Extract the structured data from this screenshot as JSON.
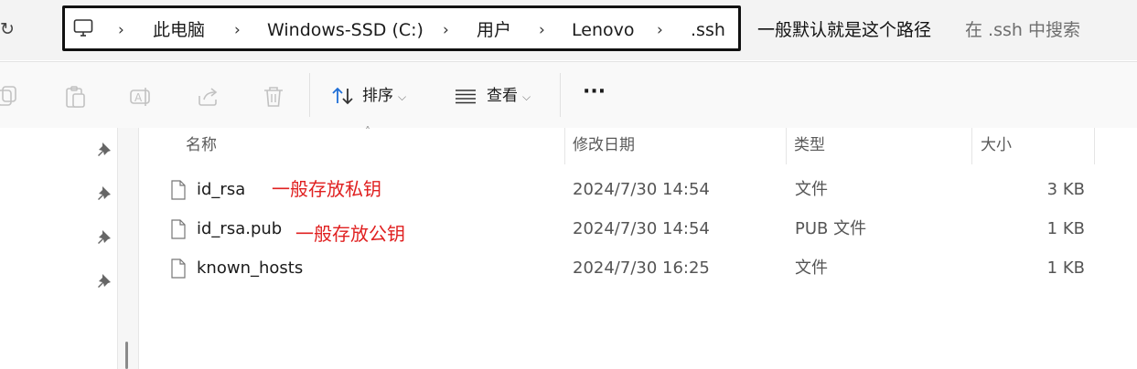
{
  "address_bar": {
    "crumbs": [
      "此电脑",
      "Windows-SSD (C:)",
      "用户",
      "Lenovo",
      ".ssh"
    ],
    "path_note": "一般默认就是这个路径",
    "search_placeholder": "在 .ssh 中搜索"
  },
  "toolbar": {
    "sort_label": "排序",
    "view_label": "查看",
    "more_label": "···"
  },
  "columns": {
    "name": "名称",
    "modified": "修改日期",
    "type": "类型",
    "size": "大小"
  },
  "files": [
    {
      "name": "id_rsa",
      "modified": "2024/7/30 14:54",
      "type": "文件",
      "size": "3 KB",
      "note": "一般存放私钥"
    },
    {
      "name": "id_rsa.pub",
      "modified": "2024/7/30 14:54",
      "type": "PUB 文件",
      "size": "1 KB",
      "note": "一般存放公钥"
    },
    {
      "name": "known_hosts",
      "modified": "2024/7/30 16:25",
      "type": "文件",
      "size": "1 KB",
      "note": ""
    }
  ],
  "icons": {
    "refresh": "refresh-icon",
    "computer": "computer-icon",
    "pin": "pin-icon",
    "file": "file-icon"
  },
  "colors": {
    "annotation": "#e02020",
    "accent": "#1f6fd6"
  }
}
